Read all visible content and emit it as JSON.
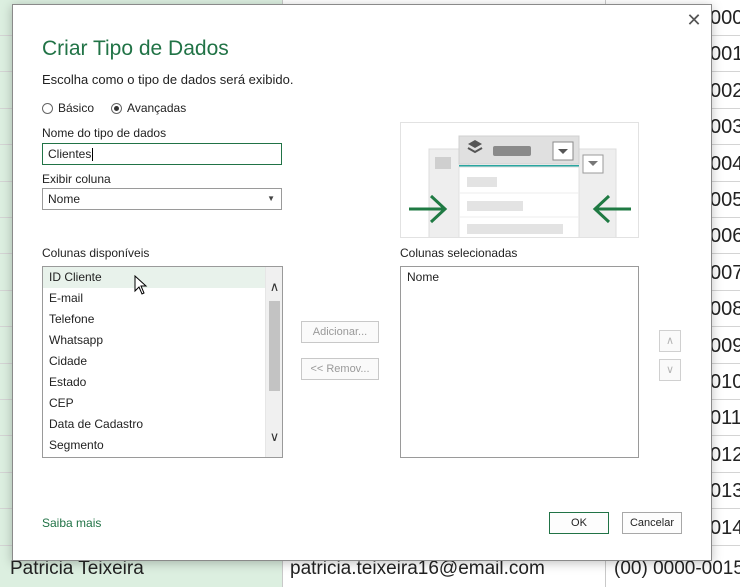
{
  "spreadsheet": {
    "id_cells": [
      "000",
      "001",
      "002",
      "003",
      "004",
      "005",
      "006",
      "007",
      "008",
      "009",
      "010",
      "011",
      "012",
      "013",
      "014"
    ],
    "bottom_row": {
      "name": "Patricia Teixeira",
      "email": "patricia.teixeira16@email.com",
      "phone": "(00) 0000-0015"
    }
  },
  "dialog": {
    "title": "Criar Tipo de Dados",
    "subtitle": "Escolha como o tipo de dados será exibido.",
    "close_icon": "close-icon",
    "mode_options": [
      {
        "label": "Básico",
        "selected": false
      },
      {
        "label": "Avançadas",
        "selected": true
      }
    ],
    "name_label": "Nome do tipo de dados",
    "name_value": "Clientes",
    "display_column_label": "Exibir coluna",
    "display_column_value": "Nome",
    "available_label": "Colunas disponíveis",
    "available_columns": [
      "ID Cliente",
      "E-mail",
      "Telefone",
      "Whatsapp",
      "Cidade",
      "Estado",
      "CEP",
      "Data de Cadastro",
      "Segmento"
    ],
    "hovered_index": 0,
    "selected_label": "Colunas selecionadas",
    "selected_columns": [
      "Nome"
    ],
    "add_button": "Adicionar...",
    "remove_button": "<< Remov...",
    "learn_more": "Saiba mais",
    "ok_button": "OK",
    "cancel_button": "Cancelar"
  },
  "colors": {
    "accent": "#217346",
    "sheet_selected_column": "#dcefe0"
  }
}
